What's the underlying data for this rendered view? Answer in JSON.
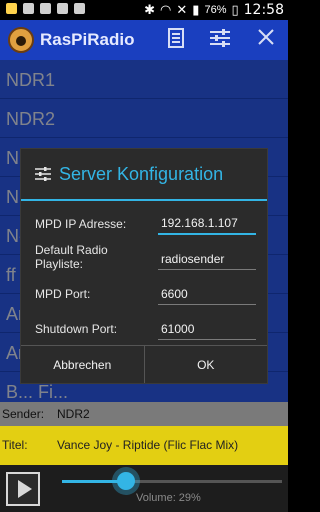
{
  "status_bar": {
    "battery_percent": "76%",
    "time": "12:58",
    "icons_left": [
      "warning-icon",
      "inbox-icon",
      "photo-icon",
      "bag-icon",
      "mail-icon"
    ],
    "icons_right": [
      "bluetooth-icon",
      "wifi-icon",
      "mute-icon",
      "signal-icon",
      "battery-icon"
    ]
  },
  "app_bar": {
    "title": "RasPiRadio",
    "actions": [
      "playlist-icon",
      "settings-sliders-icon",
      "close-icon"
    ]
  },
  "list": {
    "items": [
      "NDR1",
      "NDR2",
      "N",
      "N",
      "N-",
      "ff",
      "Ar",
      "Ar",
      "B... Fi..."
    ]
  },
  "dialog": {
    "title": "Server Konfiguration",
    "fields": [
      {
        "label": "MPD IP Adresse:",
        "value": "192.168.1.107"
      },
      {
        "label": "Default Radio\nPlayliste:",
        "value": "radiosender"
      },
      {
        "label": "MPD Port:",
        "value": "6600"
      },
      {
        "label": "Shutdown Port:",
        "value": "61000"
      }
    ],
    "cancel_label": "Abbrechen",
    "ok_label": "OK"
  },
  "info": {
    "sender_label": "Sender:",
    "sender_value": "NDR2",
    "title_label": "Titel:",
    "title_value": "Vance Joy - Riptide (Flic Flac Mix)"
  },
  "player": {
    "volume_label": "Volume: 29%",
    "volume_fraction": 0.29
  },
  "colors": {
    "app_bar": "#1a3fbf",
    "list_bg": "#2d5cf0",
    "accent": "#33b5e5",
    "title_bar": "#e3cf12",
    "sender_bar": "#7a7a7a"
  }
}
